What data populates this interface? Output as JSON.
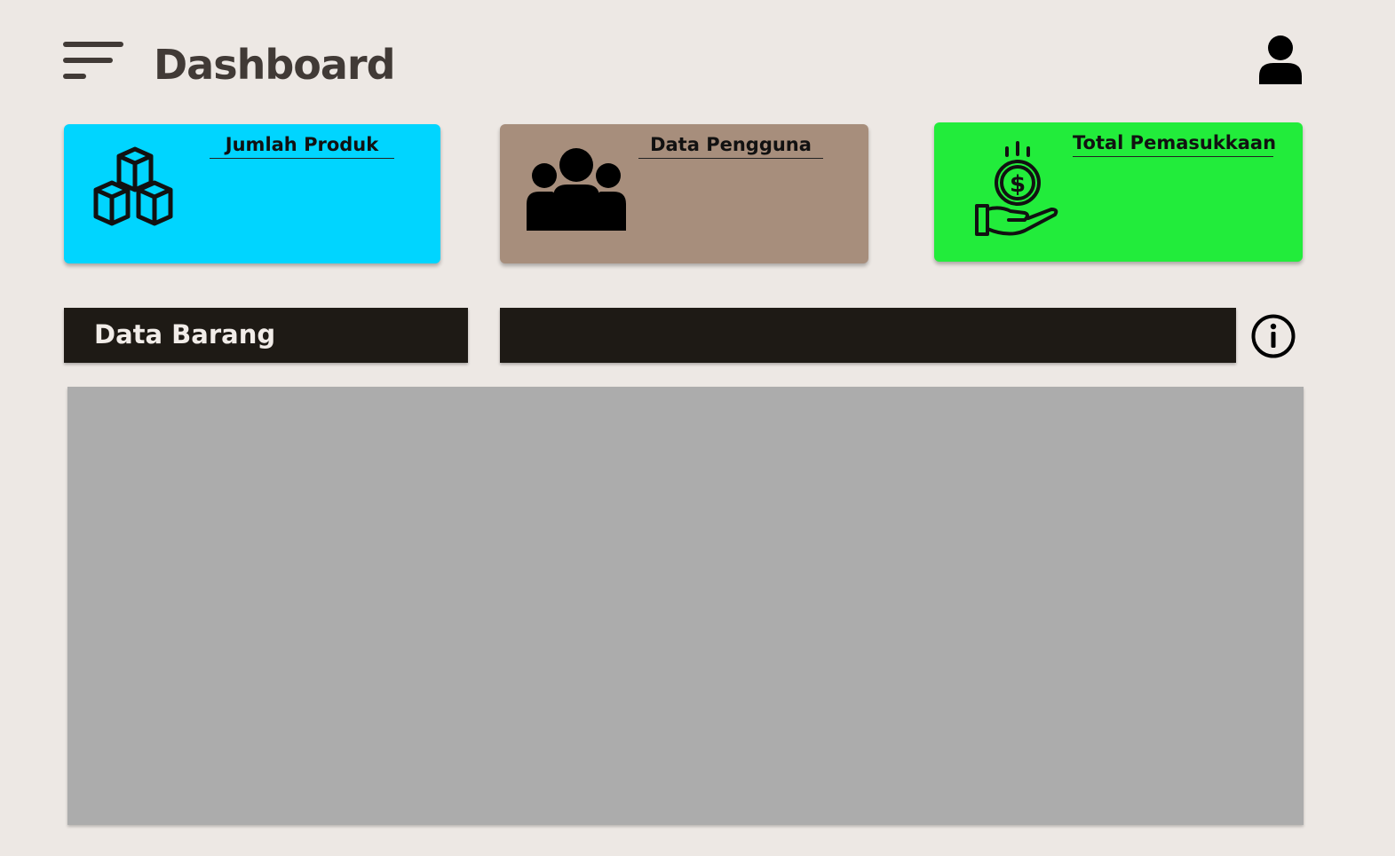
{
  "header": {
    "title": "Dashboard",
    "menu_icon": "hamburger-menu-icon",
    "profile_icon": "user-icon"
  },
  "cards": [
    {
      "title": "Jumlah Produk",
      "icon": "boxes-icon",
      "color": "#00d5ff"
    },
    {
      "title": "Data Pengguna",
      "icon": "users-group-icon",
      "color": "#a78e7c"
    },
    {
      "title": "Total Pemasukkaan",
      "icon": "money-hand-icon",
      "color": "#22ec3b"
    }
  ],
  "section": {
    "title": "Data Barang",
    "info_icon": "info-icon",
    "bar_color": "#1e1a15"
  },
  "table": {
    "background": "#acacac"
  }
}
